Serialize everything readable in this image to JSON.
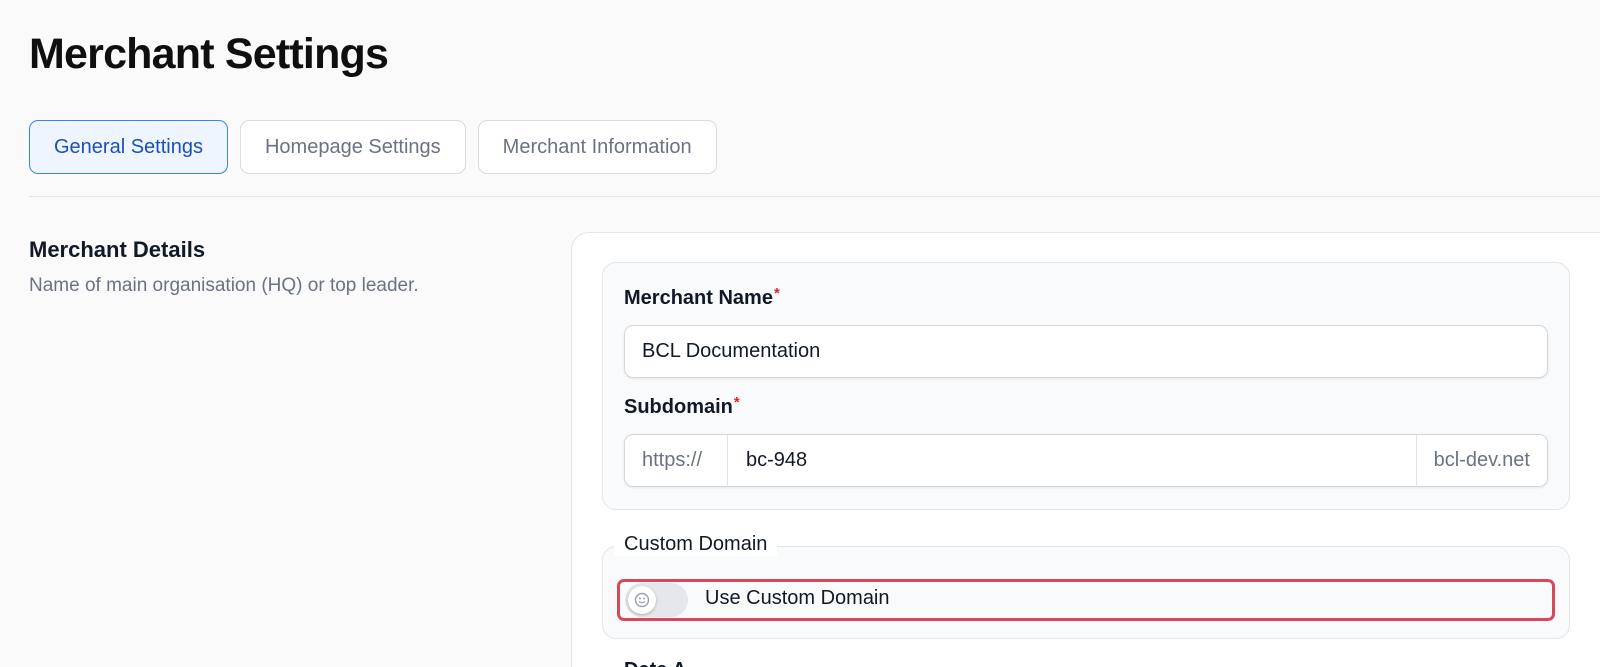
{
  "page": {
    "title": "Merchant Settings"
  },
  "tabs": [
    {
      "label": "General Settings",
      "active": true
    },
    {
      "label": "Homepage Settings",
      "active": false
    },
    {
      "label": "Merchant Information",
      "active": false
    }
  ],
  "section": {
    "title": "Merchant Details",
    "description": "Name of main organisation (HQ) or top leader."
  },
  "form": {
    "merchant_name": {
      "label": "Merchant Name",
      "required_mark": "*",
      "value": "BCL Documentation"
    },
    "subdomain": {
      "label": "Subdomain",
      "required_mark": "*",
      "prefix": "https://",
      "value": "bc-948",
      "suffix": "bcl-dev.net"
    },
    "custom_domain": {
      "legend": "Custom Domain",
      "toggle_label": "Use Custom Domain",
      "toggle_on": false,
      "toggle_icon": "smiley-icon"
    },
    "next_field_label_partial": "Date A"
  },
  "colors": {
    "accent": "#3b82f6",
    "active_tab_bg": "#eef5ff",
    "active_tab_text": "#1d4fb8",
    "required": "#dc2626",
    "highlight_outline": "#d9485a"
  }
}
